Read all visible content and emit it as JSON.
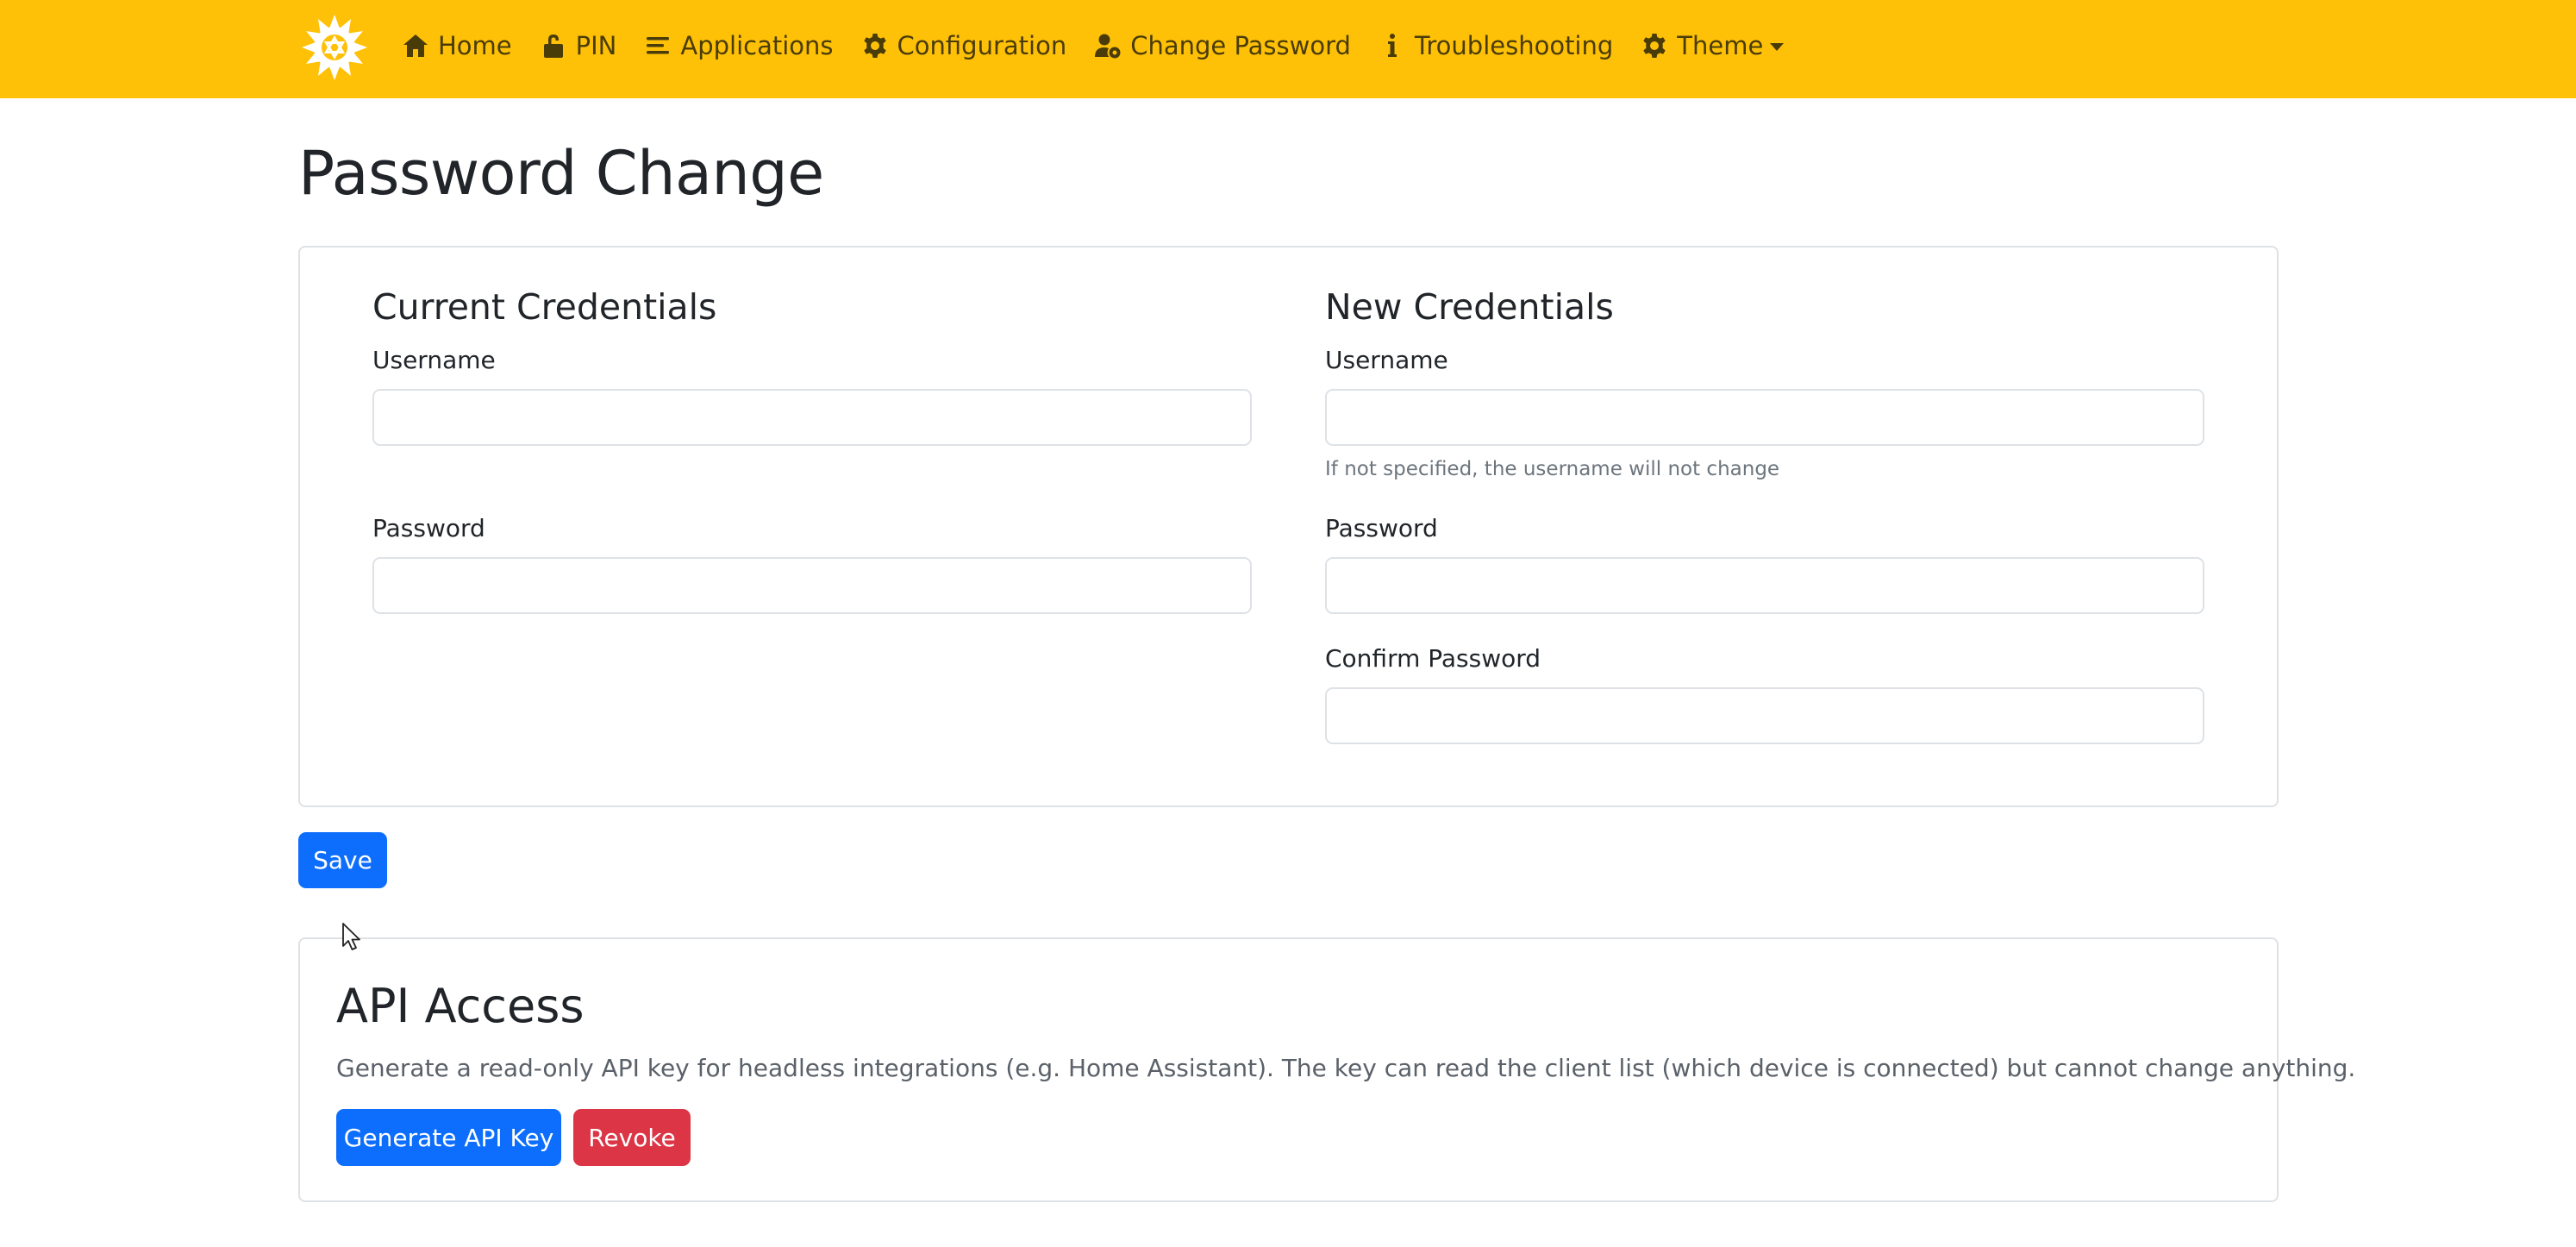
{
  "nav": {
    "items": [
      {
        "label": "Home",
        "icon": "home-icon"
      },
      {
        "label": "PIN",
        "icon": "lock-open-icon"
      },
      {
        "label": "Applications",
        "icon": "list-icon"
      },
      {
        "label": "Configuration",
        "icon": "gear-icon"
      },
      {
        "label": "Change Password",
        "icon": "user-gear-icon"
      },
      {
        "label": "Troubleshooting",
        "icon": "info-icon"
      },
      {
        "label": "Theme",
        "icon": "gear-icon"
      }
    ],
    "brand_color": "#ffc107"
  },
  "page": {
    "title": "Password Change"
  },
  "current": {
    "title": "Current Credentials",
    "username_label": "Username",
    "username_value": "",
    "password_label": "Password",
    "password_value": ""
  },
  "new": {
    "title": "New Credentials",
    "username_label": "Username",
    "username_value": "",
    "username_help": "If not specified, the username will not change",
    "password_label": "Password",
    "password_value": "",
    "confirm_label": "Confirm Password",
    "confirm_value": ""
  },
  "actions": {
    "save_label": "Save"
  },
  "api": {
    "title": "API Access",
    "description": "Generate a read-only API key for headless integrations (e.g. Home Assistant). The key can read the client list (which device is connected) but cannot change anything.",
    "generate_label": "Generate API Key",
    "revoke_label": "Revoke"
  },
  "colors": {
    "primary": "#0d6efd",
    "danger": "#dc3545"
  }
}
